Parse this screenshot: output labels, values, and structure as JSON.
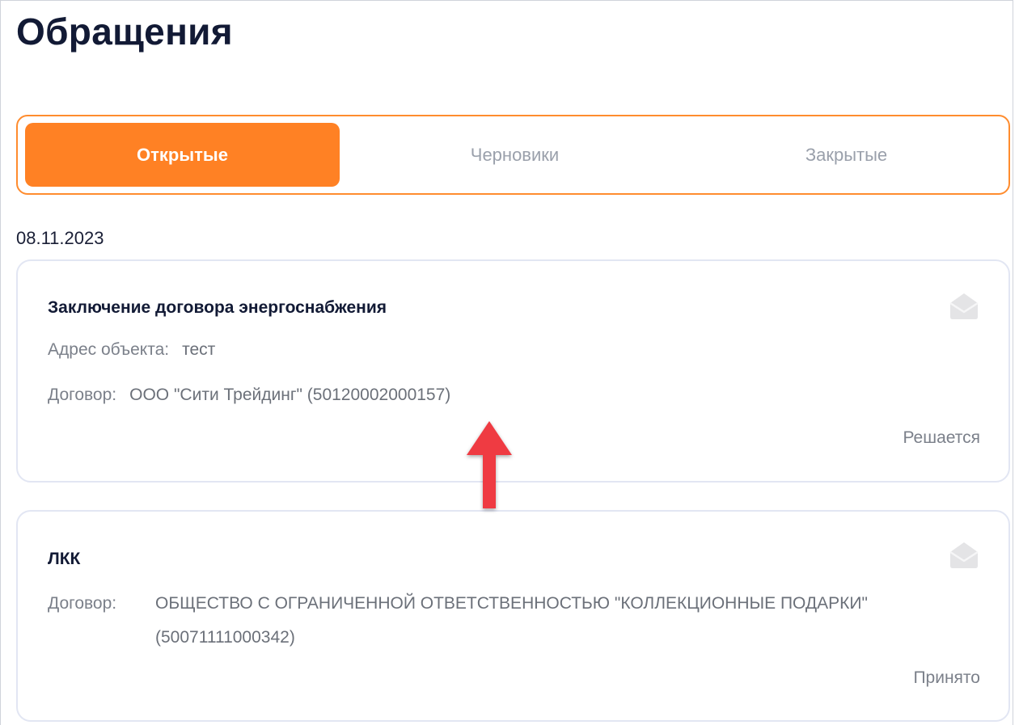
{
  "header": {
    "title": "Обращения"
  },
  "tabs": [
    {
      "label": "Открытые",
      "active": true
    },
    {
      "label": "Черновики",
      "active": false
    },
    {
      "label": "Закрытые",
      "active": false
    }
  ],
  "groups": [
    {
      "date": "08.11.2023",
      "cards": [
        {
          "title": "Заключение договора энергоснабжения",
          "address_label": "Адрес объекта:",
          "address_value": "тест",
          "contract_label": "Договор:",
          "contract_value": "ООО \"Сити Трейдинг\" (50120002000157)",
          "status": "Решается",
          "icon": "envelope-open-icon"
        },
        {
          "title": "ЛКК",
          "contract_label": "Договор:",
          "contract_value": "ОБЩЕСТВО С ОГРАНИЧЕННОЙ ОТВЕТСТВЕННОСТЬЮ \"КОЛЛЕКЦИОННЫЕ ПОДАРКИ\" (50071111000342)",
          "status": "Принято",
          "icon": "envelope-open-icon"
        }
      ]
    }
  ],
  "colors": {
    "accent": "#ff8124",
    "tab_border": "#ff8c2e",
    "card_border": "#e2e6f3",
    "muted_text": "#7b808a",
    "annotation_arrow": "#ef3b42"
  }
}
